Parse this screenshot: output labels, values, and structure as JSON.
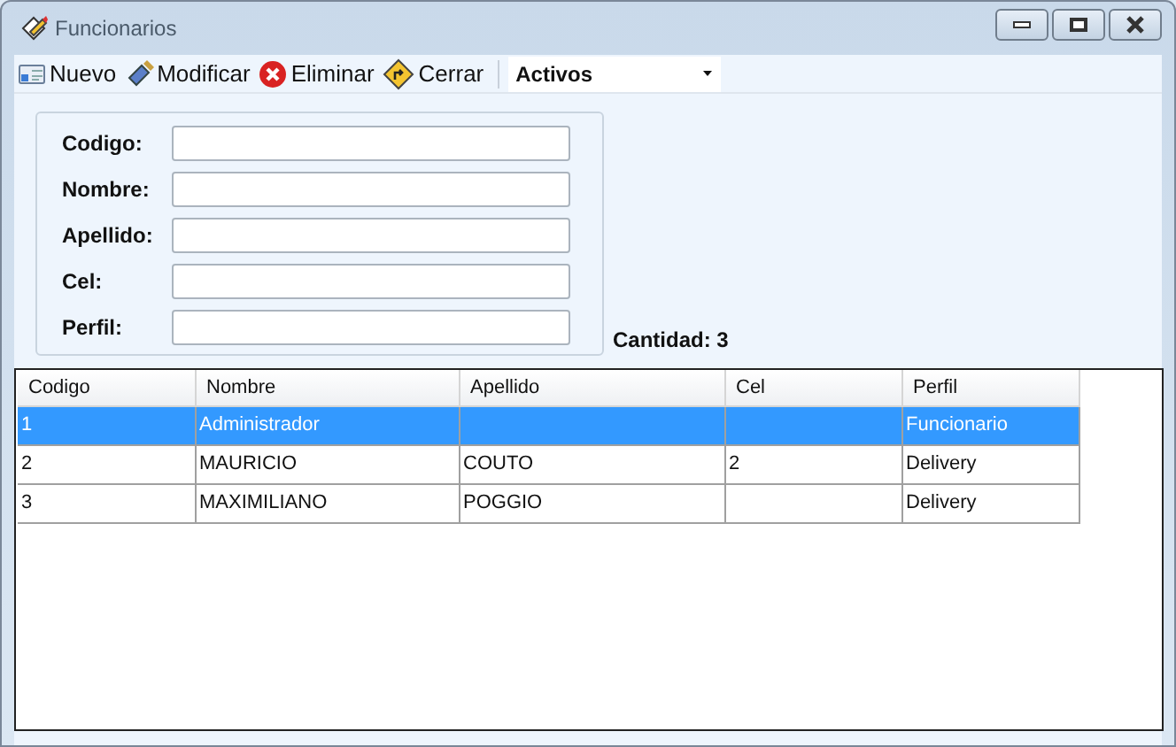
{
  "window": {
    "title": "Funcionarios"
  },
  "toolbar": {
    "buttons": [
      {
        "label": "Nuevo",
        "kind": "new"
      },
      {
        "label": "Modificar",
        "kind": "edit"
      },
      {
        "label": "Eliminar",
        "kind": "delete"
      },
      {
        "label": "Cerrar",
        "kind": "close"
      }
    ],
    "filter": {
      "value": "Activos"
    }
  },
  "form": {
    "fields": [
      {
        "label": "Codigo:"
      },
      {
        "label": "Nombre:"
      },
      {
        "label": "Apellido:"
      },
      {
        "label": "Cel:"
      },
      {
        "label": "Perfil:"
      }
    ]
  },
  "count": "Cantidad: 3",
  "table": {
    "columns": [
      "Codigo",
      "Nombre",
      "Apellido",
      "Cel",
      "Perfil"
    ],
    "rows": [
      {
        "selected": true,
        "cells": [
          "1",
          "Administrador",
          null,
          null,
          "Funcionario"
        ]
      },
      {
        "selected": false,
        "cells": [
          "2",
          "MAURICIO",
          "COUTO",
          "2",
          "Delivery"
        ]
      },
      {
        "selected": false,
        "cells": [
          "3",
          "MAXIMILIANO",
          "POGGIO",
          null,
          "Delivery"
        ]
      }
    ]
  }
}
